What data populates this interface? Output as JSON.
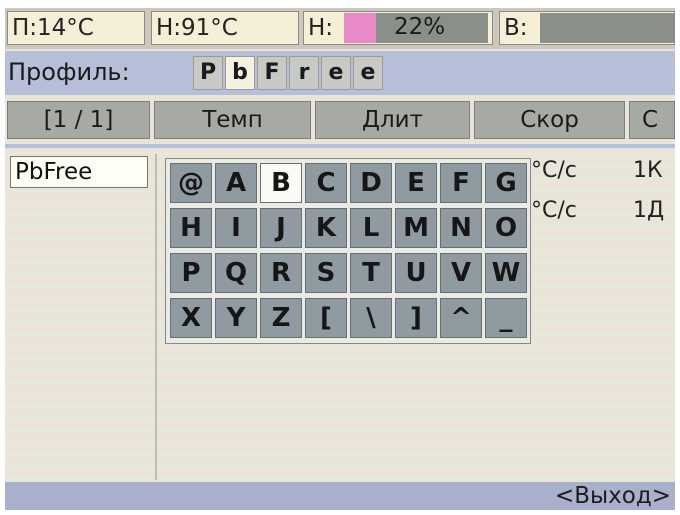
{
  "status_bar": {
    "p_temp": "П:14°C",
    "h_temp": "Н:91°C",
    "h_label": "Н:",
    "h_power_text": "22%",
    "h_power_percent": 22,
    "v_label": "В:",
    "v_power_percent": 0
  },
  "profile": {
    "label": "Профиль:",
    "chars": [
      "P",
      "b",
      "F",
      "r",
      "e",
      "e"
    ],
    "active_index": 1
  },
  "table": {
    "headers": [
      "[1 / 1]",
      "Темп",
      "Длит",
      "Скор",
      "С"
    ],
    "row_name": "PbFree",
    "row1_rate": "°С/с",
    "row1_tail": "1К",
    "row2_rate": "°С/с",
    "row2_tail": "1Д"
  },
  "keyboard": {
    "rows": [
      [
        "@",
        "A",
        "B",
        "C",
        "D",
        "E",
        "F",
        "G"
      ],
      [
        "H",
        "I",
        "J",
        "K",
        "L",
        "M",
        "N",
        "O"
      ],
      [
        "P",
        "Q",
        "R",
        "S",
        "T",
        "U",
        "V",
        "W"
      ],
      [
        "X",
        "Y",
        "Z",
        "[",
        "\\",
        "]",
        "^",
        "_"
      ]
    ],
    "selected": "B"
  },
  "footer": {
    "exit_label": "<Выход>"
  }
}
